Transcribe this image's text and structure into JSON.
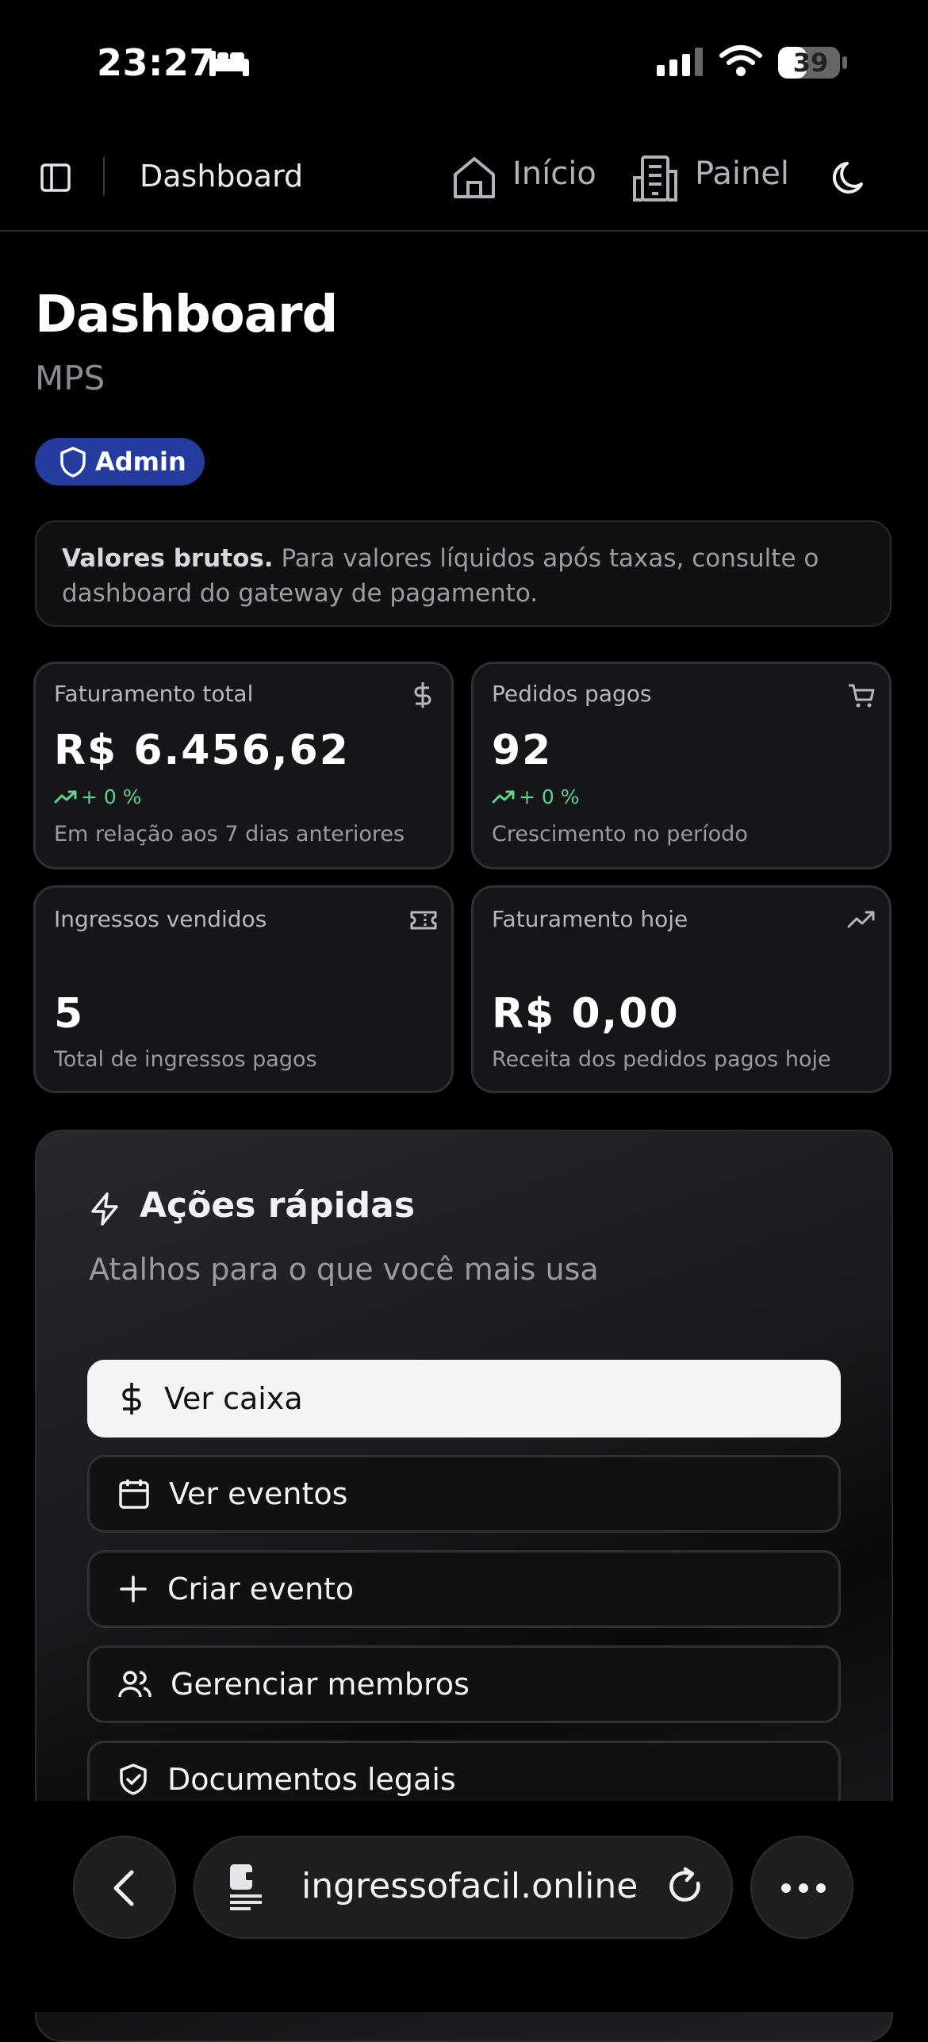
{
  "status_bar": {
    "time": "23:27",
    "battery": "39"
  },
  "nav": {
    "title": "Dashboard",
    "links": [
      {
        "label": "Início"
      },
      {
        "label": "Painel"
      }
    ]
  },
  "page": {
    "title": "Dashboard",
    "subtitle": "MPS",
    "role_badge": "Admin"
  },
  "notice": {
    "bold": "Valores brutos.",
    "text": " Para valores líquidos após taxas, consulte o dashboard do gateway de pagamento."
  },
  "stats": [
    {
      "label": "Faturamento total",
      "value": "R$ 6.456,62",
      "trend": "+ 0 %",
      "desc": "Em relação aos 7 dias anteriores",
      "icon": "dollar-icon"
    },
    {
      "label": "Pedidos pagos",
      "value": "92",
      "trend": "+ 0 %",
      "desc": "Crescimento no período",
      "icon": "cart-icon"
    },
    {
      "label": "Ingressos vendidos",
      "value": "5",
      "desc": "Total de ingressos pagos",
      "icon": "ticket-icon"
    },
    {
      "label": "Faturamento hoje",
      "value": "R$ 0,00",
      "desc": "Receita dos pedidos pagos hoje",
      "icon": "trending-up-icon"
    }
  ],
  "quick_actions": {
    "title": "Ações rápidas",
    "subtitle": "Atalhos para o que você mais usa",
    "items": [
      {
        "label": "Ver caixa",
        "icon": "dollar-icon"
      },
      {
        "label": "Ver eventos",
        "icon": "calendar-icon"
      },
      {
        "label": "Criar evento",
        "icon": "plus-icon"
      },
      {
        "label": "Gerenciar membros",
        "icon": "users-icon"
      },
      {
        "label": "Documentos legais",
        "icon": "shield-check-icon"
      }
    ]
  },
  "browser": {
    "url": "ingressofacil.online"
  },
  "colors": {
    "background": "#000000",
    "badge": "#243c9e",
    "trend": "#5fd38a",
    "card": "#16161a"
  }
}
